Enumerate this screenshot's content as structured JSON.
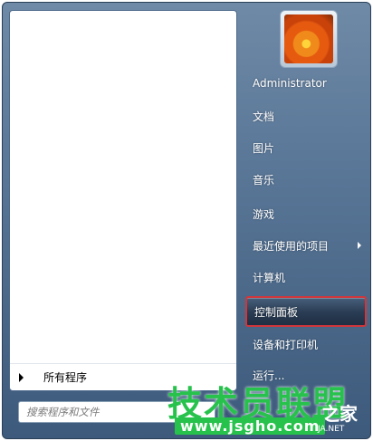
{
  "left_pane": {
    "all_programs_label": "所有程序"
  },
  "search": {
    "placeholder": "搜索程序和文件"
  },
  "user": {
    "name": "Administrator"
  },
  "right_items": [
    {
      "label": "文档"
    },
    {
      "label": "图片"
    },
    {
      "label": "音乐"
    },
    {
      "label": "游戏"
    },
    {
      "label": "最近使用的项目"
    },
    {
      "label": "计算机"
    },
    {
      "label": "控制面板"
    },
    {
      "label": "设备和打印机"
    },
    {
      "label": "运行..."
    }
  ],
  "watermark": {
    "cn_main": "技术员联盟",
    "cn_tail": "之家",
    "url": "www.jsgho.com",
    "net": "JA.NET"
  },
  "colors": {
    "highlight_border": "#d0363b",
    "watermark_green": "#27c24c"
  }
}
